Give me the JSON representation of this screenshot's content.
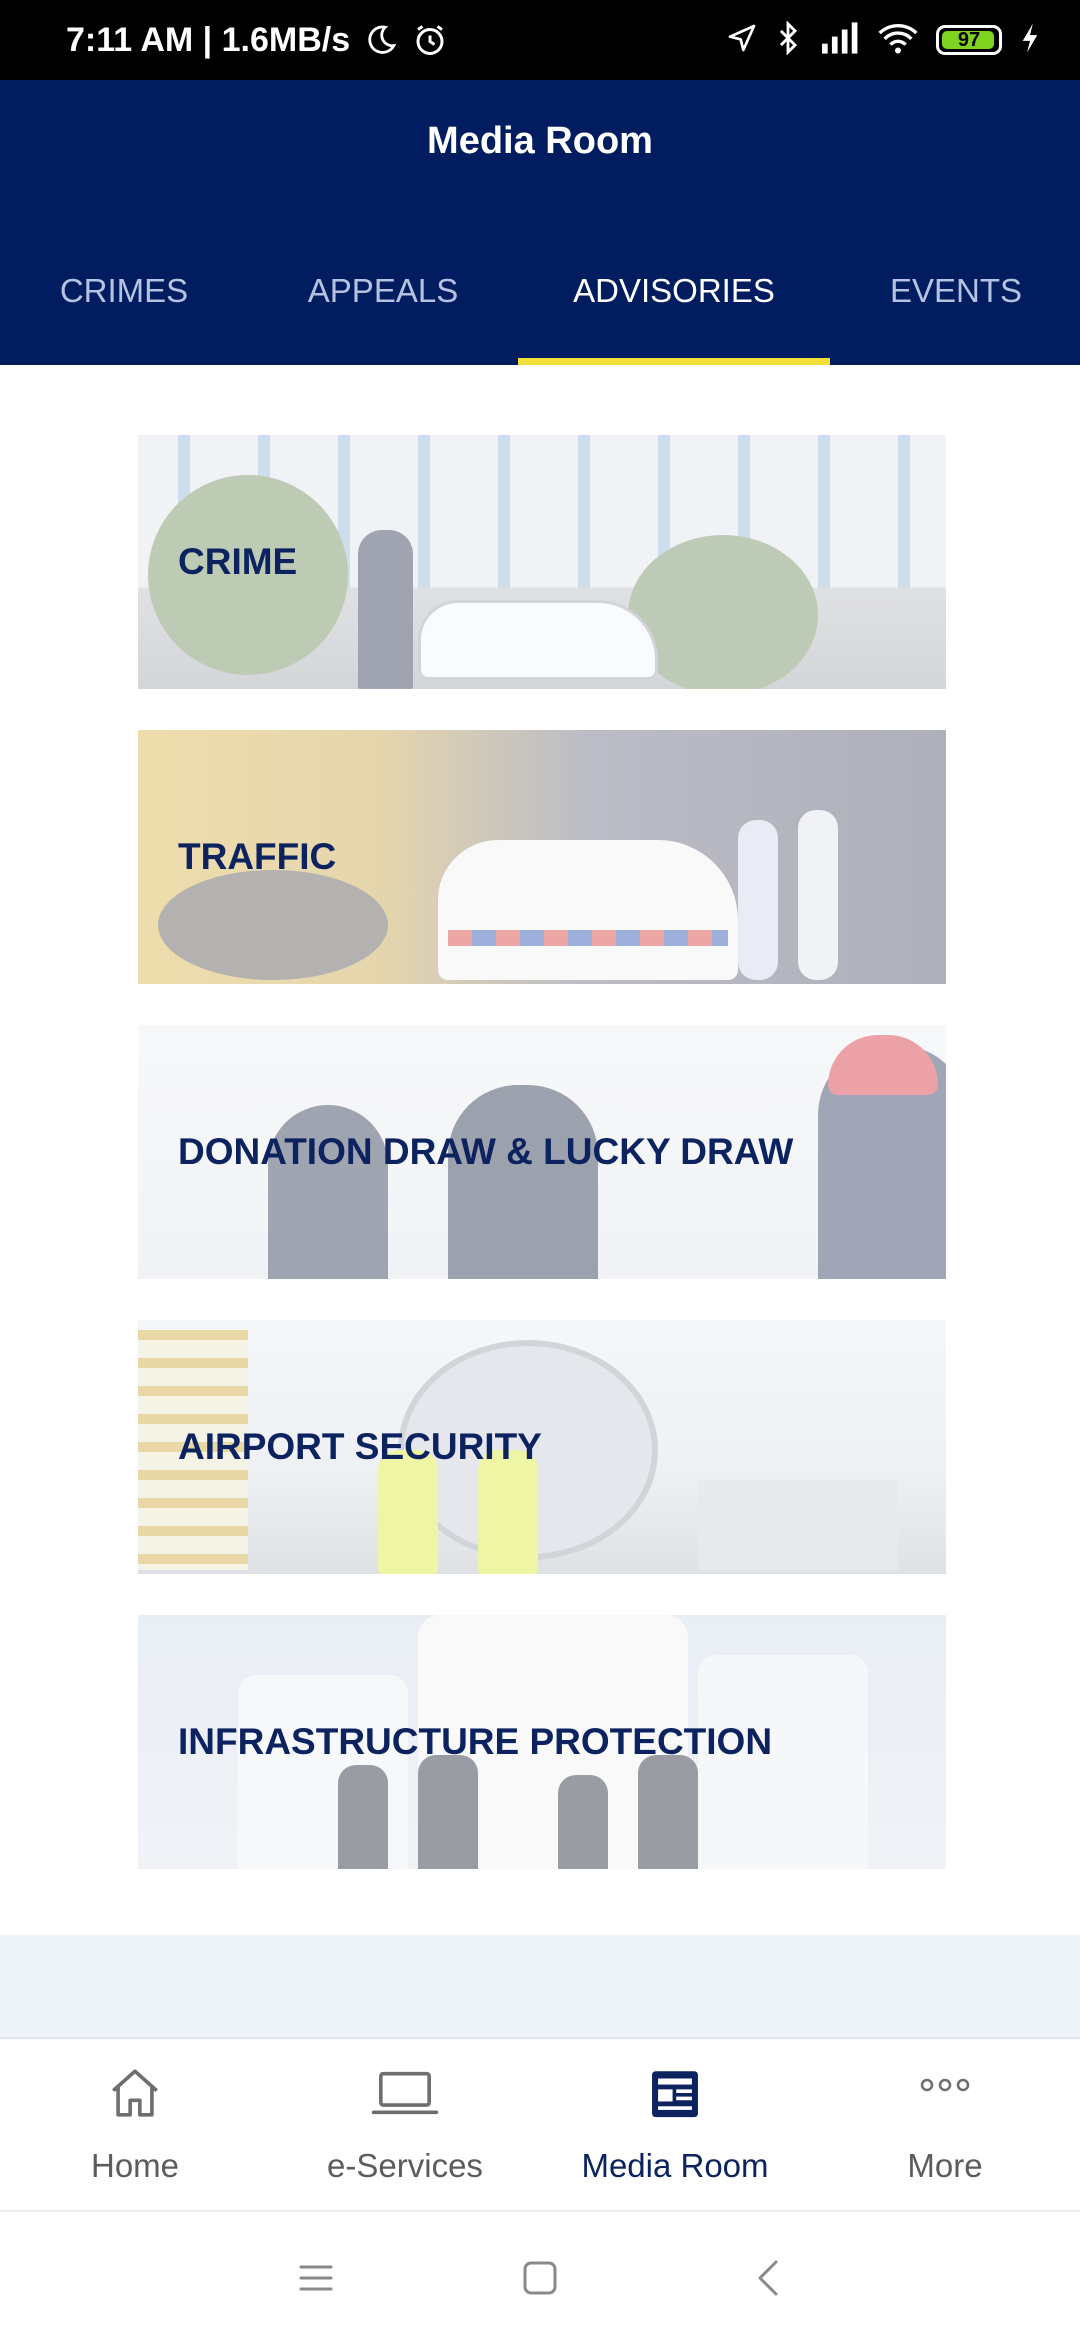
{
  "status_bar": {
    "time_speed": "7:11 AM | 1.6MB/s",
    "battery": "97",
    "icons": [
      "moon-icon",
      "alarm-icon",
      "location-icon",
      "bluetooth-icon",
      "signal-icon",
      "wifi-icon",
      "battery-icon",
      "charging-icon"
    ]
  },
  "header": {
    "title": "Media Room"
  },
  "tabs": [
    {
      "label": "CRIMES"
    },
    {
      "label": "APPEALS"
    },
    {
      "label": "ADVISORIES"
    },
    {
      "label": "EVENTS"
    }
  ],
  "active_tab": "ADVISORIES",
  "cards": [
    {
      "label": "CRIME"
    },
    {
      "label": "TRAFFIC"
    },
    {
      "label": "DONATION DRAW & LUCKY DRAW"
    },
    {
      "label": "AIRPORT SECURITY"
    },
    {
      "label": "INFRASTRUCTURE PROTECTION"
    }
  ],
  "bottom_nav": [
    {
      "label": "Home",
      "icon": "home-icon"
    },
    {
      "label": "e-Services",
      "icon": "laptop-icon"
    },
    {
      "label": "Media Room",
      "icon": "newspaper-icon"
    },
    {
      "label": "More",
      "icon": "more-icon"
    }
  ],
  "active_nav": "Media Room",
  "colors": {
    "header_bg": "#021d5f",
    "tab_indicator": "#f2df3a",
    "card_text": "#0c2360",
    "battery_fill": "#7ed321"
  }
}
